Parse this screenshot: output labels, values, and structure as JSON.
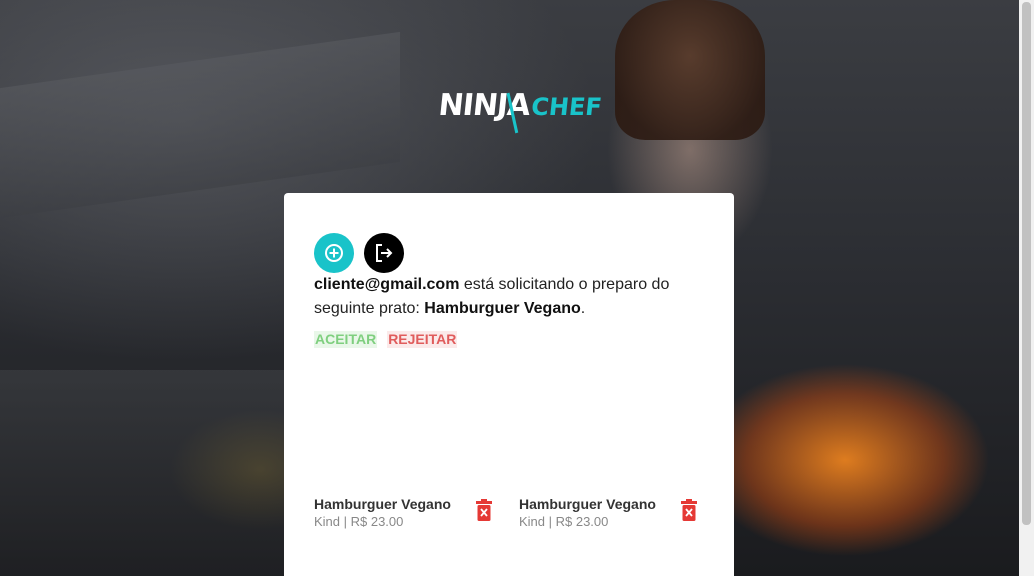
{
  "logo": {
    "part1": "NINJA",
    "part2": "CHEF"
  },
  "toolbar": {
    "add_icon": "plus-circle-icon",
    "logout_icon": "logout-icon"
  },
  "message": {
    "email": "cliente@gmail.com",
    "text": " está solicitando o preparo do seguinte prato: ",
    "dish": "Hamburguer Vegano",
    "end": "."
  },
  "actions": {
    "accept": "ACEITAR",
    "reject": "REJEITAR"
  },
  "items": [
    {
      "title": "Hamburguer Vegano",
      "subtitle": "Kind | R$ 23.00"
    },
    {
      "title": "Hamburguer Vegano",
      "subtitle": "Kind | R$ 23.00"
    }
  ],
  "colors": {
    "accent": "#19c3c9",
    "accept": "#7fcf7f",
    "reject": "#e05c5c"
  }
}
